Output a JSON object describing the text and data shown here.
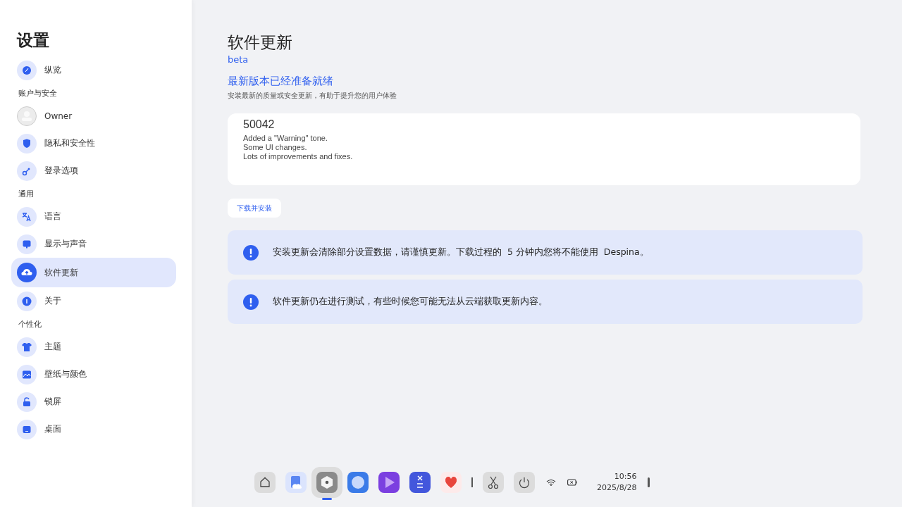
{
  "sidebar": {
    "title": "设置",
    "entries": [
      {
        "kind": "item",
        "label": "纵览",
        "selected": false
      },
      {
        "kind": "section",
        "label": "账户与安全"
      },
      {
        "kind": "avatar",
        "label": "Owner",
        "selected": false
      },
      {
        "kind": "item",
        "label": "隐私和安全性",
        "selected": false
      },
      {
        "kind": "item",
        "label": "登录选项",
        "selected": false
      },
      {
        "kind": "section",
        "label": "通用"
      },
      {
        "kind": "item",
        "label": "语言",
        "selected": false
      },
      {
        "kind": "item",
        "label": "显示与声音",
        "selected": false
      },
      {
        "kind": "item",
        "label": "软件更新",
        "selected": true
      },
      {
        "kind": "item",
        "label": "关于",
        "selected": false
      },
      {
        "kind": "section",
        "label": "个性化"
      },
      {
        "kind": "item",
        "label": "主题",
        "selected": false
      },
      {
        "kind": "item",
        "label": "壁纸与颜色",
        "selected": false
      },
      {
        "kind": "item",
        "label": "锁屏",
        "selected": false
      },
      {
        "kind": "item",
        "label": "桌面",
        "selected": false
      }
    ]
  },
  "page": {
    "title": "软件更新",
    "channel": "beta",
    "headline": "最新版本已经准备就绪",
    "subtitle": "安装最新的质量或安全更新，有助于提升您的用户体验",
    "update": {
      "version": "50042",
      "notes": [
        "Added a \"Warning\" tone.",
        "Some UI changes.",
        "Lots of improvements and fixes."
      ]
    },
    "button": "下载并安装",
    "notices": [
      "安装更新会清除部分设置数据，请谨慎更新。下载过程的  5 分钟内您将不能使用  Despina。",
      "软件更新仍在进行测试，有些时候您可能无法从云端获取更新内容。"
    ]
  },
  "taskbar": {
    "apps": [
      {
        "selected": false
      },
      {
        "selected": false
      },
      {
        "selected": true
      },
      {
        "selected": false
      },
      {
        "selected": false
      },
      {
        "selected": false
      },
      {
        "selected": false
      }
    ],
    "time": "10:56",
    "date": "2025/8/28"
  }
}
